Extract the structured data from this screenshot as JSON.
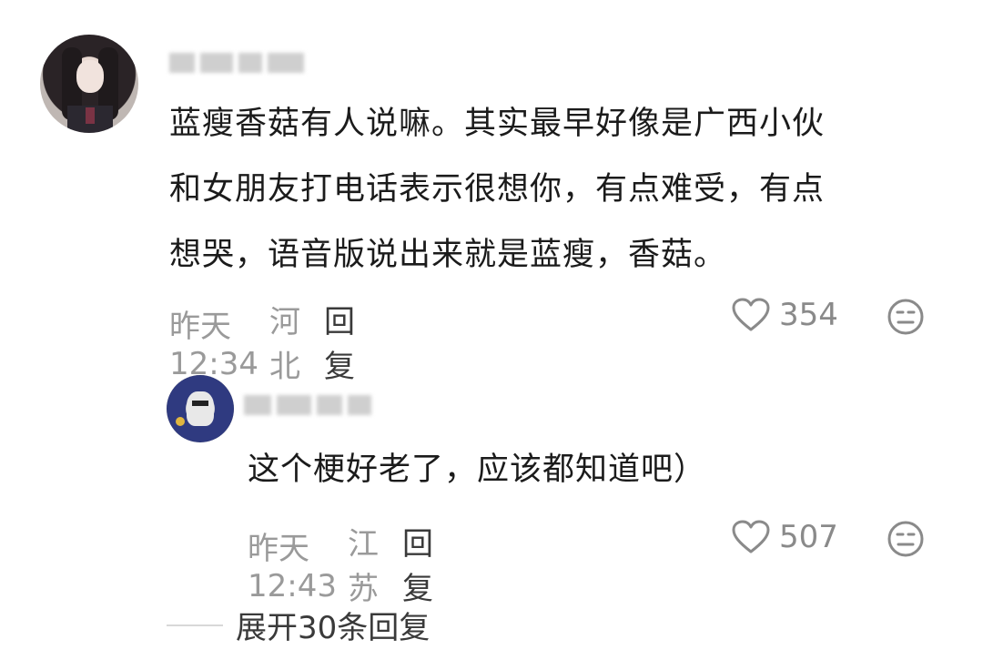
{
  "comments": [
    {
      "text": "蓝瘦香菇有人说嘛。其实最早好像是广西小伙\n和女朋友打电话表示很想你，有点难受，有点\n想哭，语音版说出来就是蓝瘦，香菇。",
      "time": "昨天 12:34",
      "location": "河北",
      "reply_label": "回复",
      "likes": "354"
    }
  ],
  "replies": [
    {
      "text": "这个梗好老了，应该都知道吧）",
      "time": "昨天 12:43",
      "location": "江苏",
      "reply_label": "回复",
      "likes": "507"
    }
  ],
  "expand_label": "展开30条回复",
  "icons": {
    "like": "heart-outline-icon",
    "dislike": "meh-face-icon"
  },
  "colors": {
    "text": "#1b1b1b",
    "meta": "#9a9a9a",
    "action": "#3a3a3a"
  }
}
